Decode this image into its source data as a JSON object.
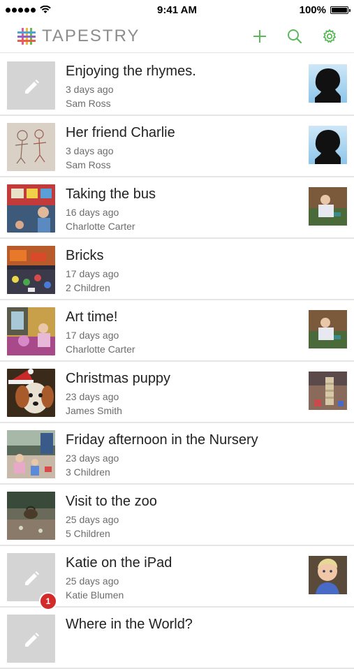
{
  "status_bar": {
    "time": "9:41 AM",
    "battery": "100%"
  },
  "header": {
    "brand_name": "TAPESTRY",
    "actions": [
      {
        "name": "add",
        "icon": "plus-icon"
      },
      {
        "name": "search",
        "icon": "search-icon"
      },
      {
        "name": "settings",
        "icon": "gear-icon"
      }
    ],
    "accent_color": "#5cb85c"
  },
  "observations": [
    {
      "title": "Enjoying the rhymes.",
      "time": "3 days ago",
      "author": "Sam Ross",
      "thumb": "placeholder-pencil",
      "avatar": "silhouette"
    },
    {
      "title": "Her friend Charlie",
      "time": "3 days ago",
      "author": "Sam Ross",
      "thumb": "drawing",
      "avatar": "silhouette"
    },
    {
      "title": "Taking the bus",
      "time": "16 days ago",
      "author": "Charlotte Carter",
      "thumb": "bus-photo",
      "avatar": "child-photo"
    },
    {
      "title": "Bricks",
      "time": "17 days ago",
      "author": "2 Children",
      "thumb": "bricks-photo",
      "avatar": ""
    },
    {
      "title": "Art time!",
      "time": "17 days ago",
      "author": "Charlotte Carter",
      "thumb": "art-photo",
      "avatar": "child-photo"
    },
    {
      "title": "Christmas puppy",
      "time": "23 days ago",
      "author": "James Smith",
      "thumb": "puppy-photo",
      "avatar": "blocks-photo"
    },
    {
      "title": "Friday afternoon in the Nursery",
      "time": "23 days ago",
      "author": "3 Children",
      "thumb": "nursery-photo",
      "avatar": ""
    },
    {
      "title": "Visit to the zoo",
      "time": "25 days ago",
      "author": "5 Children",
      "thumb": "zoo-photo",
      "avatar": ""
    },
    {
      "title": "Katie on the iPad",
      "time": "25 days ago",
      "author": "Katie Blumen",
      "thumb": "placeholder-pencil",
      "avatar": "toddler-photo",
      "badge": "1"
    },
    {
      "title": "Where in the World?",
      "time": "",
      "author": "",
      "thumb": "placeholder-pencil",
      "avatar": ""
    }
  ]
}
